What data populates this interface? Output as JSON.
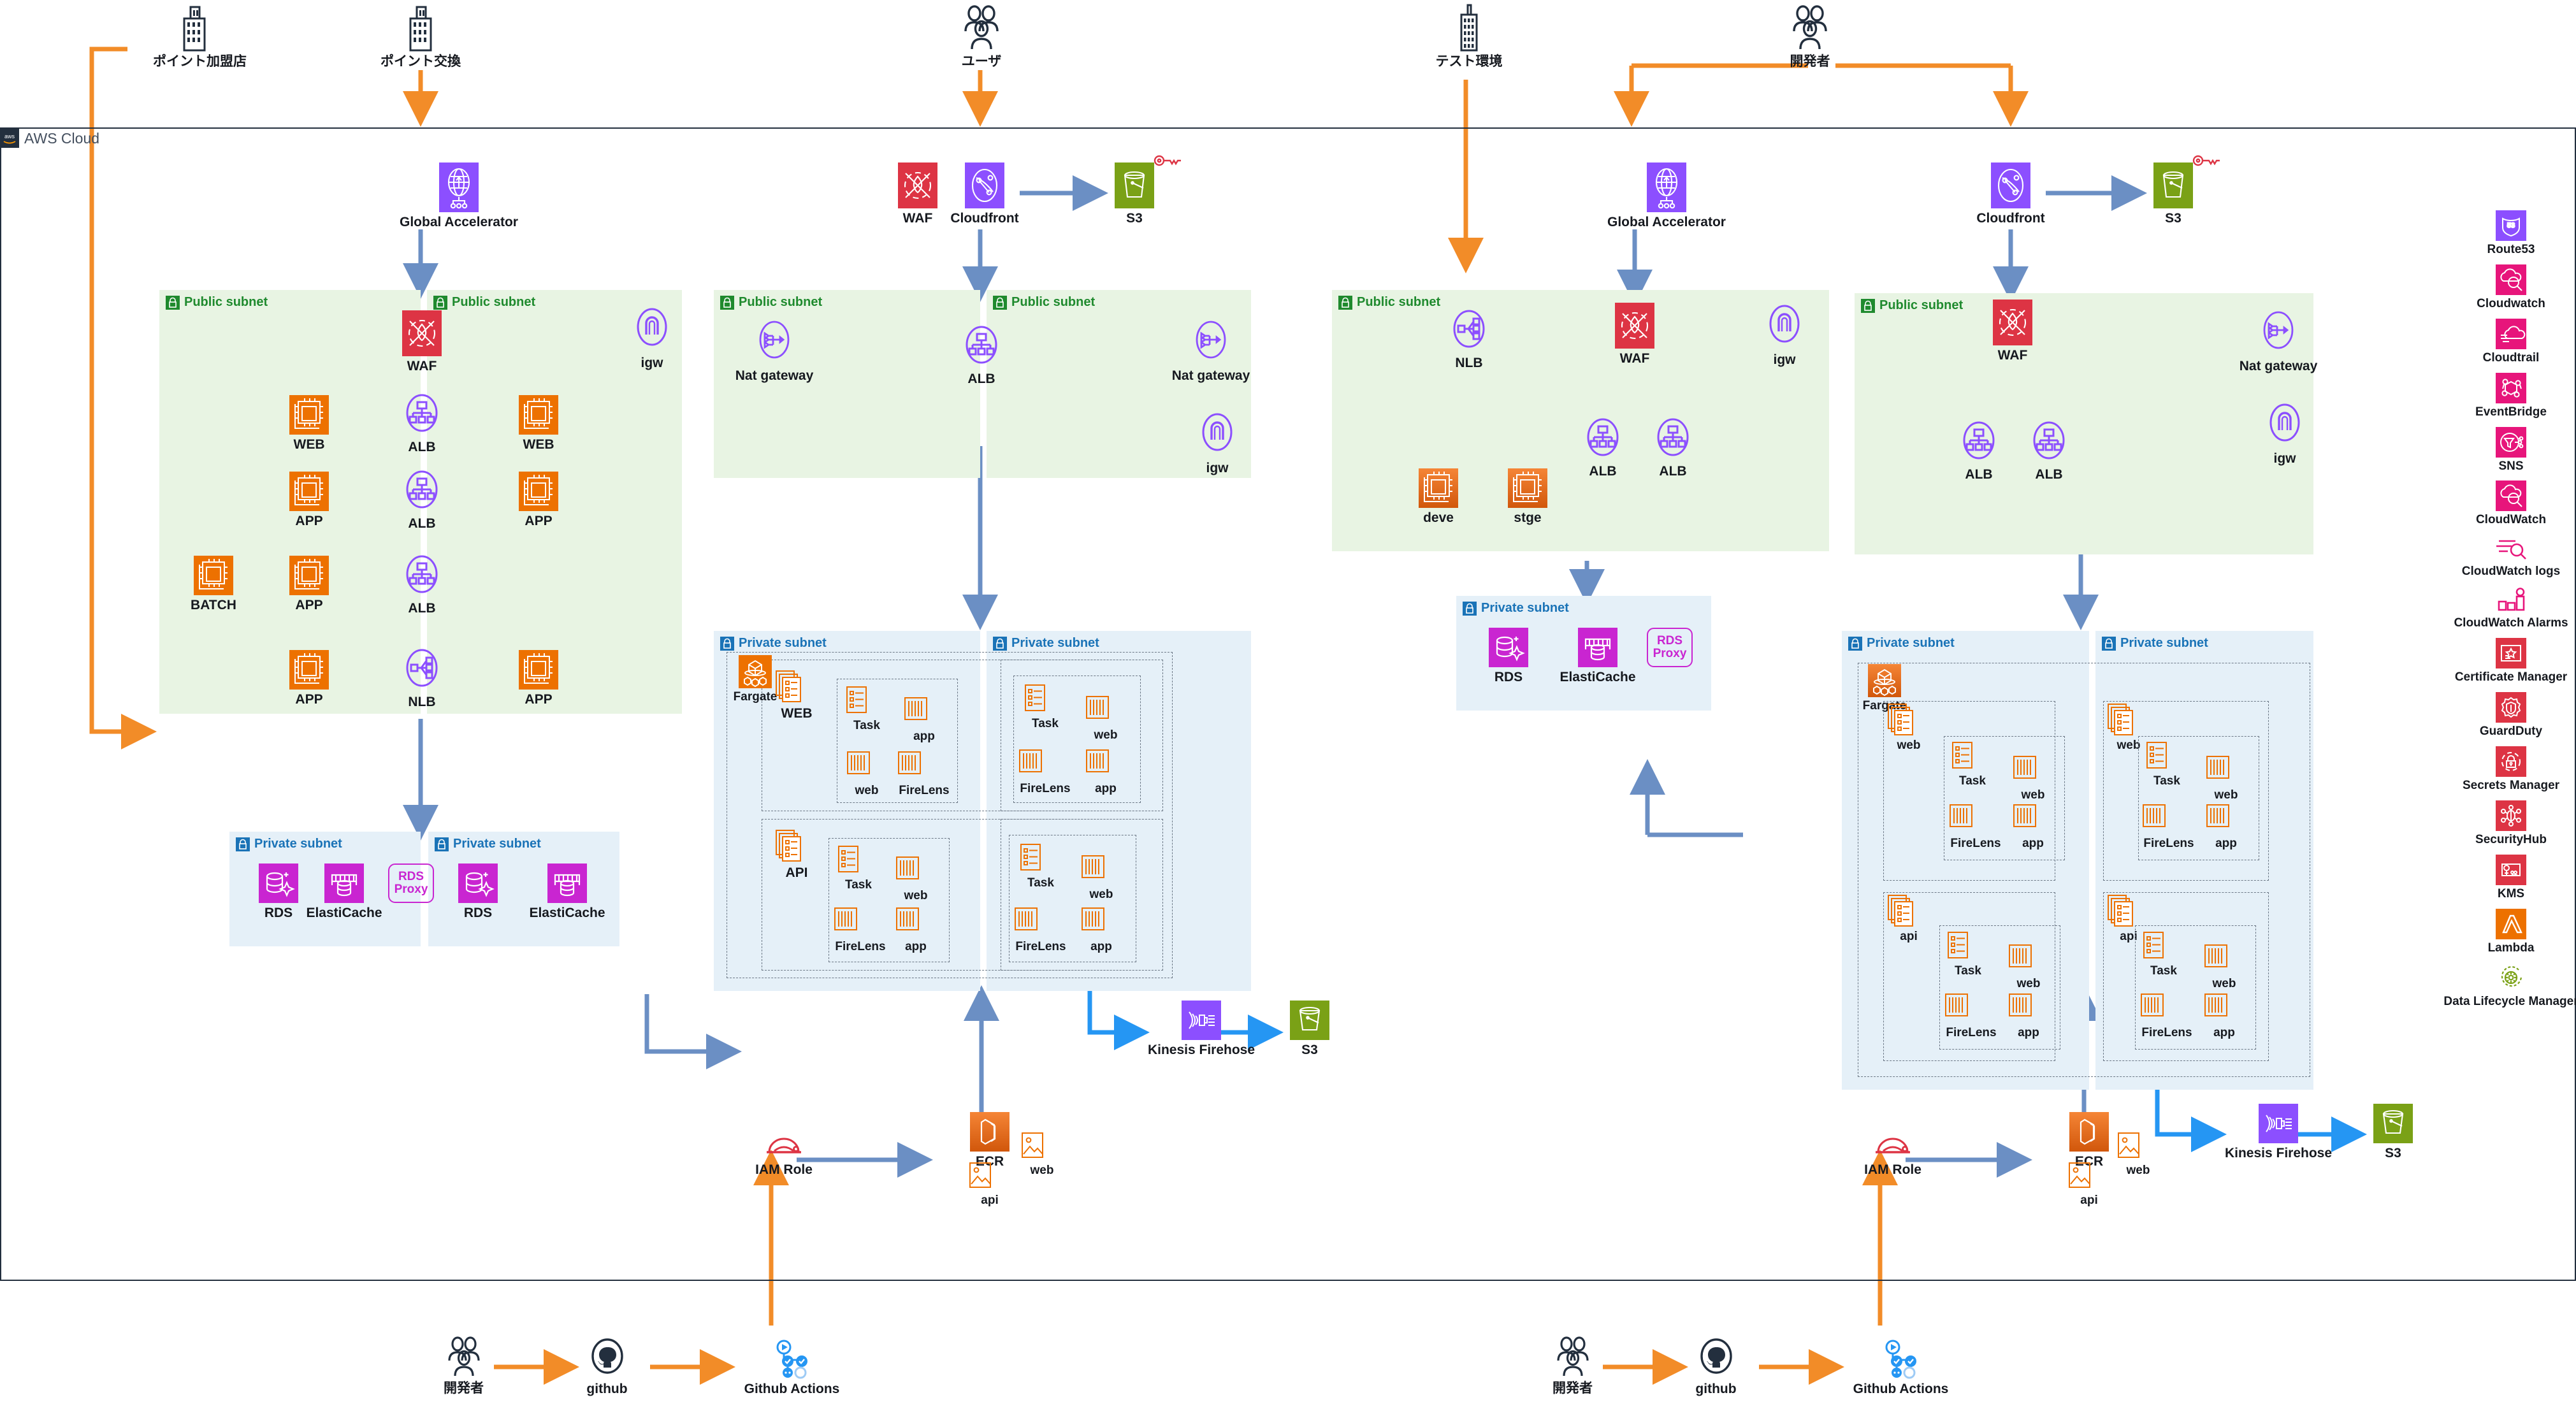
{
  "diagram": {
    "title": "AWS Cloud",
    "cloud_label": "AWS Cloud",
    "aws_badge": "aws"
  },
  "external_actors": [
    {
      "id": "point-merchant",
      "label": "ポイント加盟店",
      "icon": "building-icon"
    },
    {
      "id": "point-exchange",
      "label": "ポイント交換",
      "icon": "building-icon"
    },
    {
      "id": "users",
      "label": "ユーザ",
      "icon": "users-icon"
    },
    {
      "id": "test-env",
      "label": "テスト環境",
      "icon": "building-tall-icon"
    },
    {
      "id": "developers-top",
      "label": "開発者",
      "icon": "users-icon"
    },
    {
      "id": "developer-left",
      "label": "開発者",
      "icon": "users-icon"
    },
    {
      "id": "developer-right",
      "label": "開発者",
      "icon": "users-icon"
    }
  ],
  "edge_services": [
    {
      "id": "ga-left",
      "label": "Global Accelerator",
      "icon": "global-accelerator-icon"
    },
    {
      "id": "waf-mid",
      "label": "WAF",
      "icon": "waf-icon"
    },
    {
      "id": "cloudfront-mid",
      "label": "Cloudfront",
      "icon": "cloudfront-icon"
    },
    {
      "id": "s3-mid",
      "label": "S3",
      "icon": "s3-icon"
    },
    {
      "id": "ga-test",
      "label": "Global Accelerator",
      "icon": "global-accelerator-icon"
    },
    {
      "id": "cloudfront-right",
      "label": "Cloudfront",
      "icon": "cloudfront-icon"
    },
    {
      "id": "s3-right",
      "label": "S3",
      "icon": "s3-icon"
    }
  ],
  "vpc1": {
    "public_subnets": [
      {
        "label": "Public subnet"
      },
      {
        "label": "Public subnet"
      }
    ],
    "nodes": [
      {
        "id": "waf",
        "label": "WAF",
        "icon": "waf-icon"
      },
      {
        "id": "igw",
        "label": "igw",
        "icon": "igw-icon"
      },
      {
        "id": "web-l",
        "label": "WEB",
        "icon": "ec2-icon"
      },
      {
        "id": "alb1",
        "label": "ALB",
        "icon": "alb-icon"
      },
      {
        "id": "web-r",
        "label": "WEB",
        "icon": "ec2-icon"
      },
      {
        "id": "app-l1",
        "label": "APP",
        "icon": "ec2-icon"
      },
      {
        "id": "alb2",
        "label": "ALB",
        "icon": "alb-icon"
      },
      {
        "id": "app-r1",
        "label": "APP",
        "icon": "ec2-icon"
      },
      {
        "id": "batch",
        "label": "BATCH",
        "icon": "ec2-icon"
      },
      {
        "id": "app-l2",
        "label": "APP",
        "icon": "ec2-icon"
      },
      {
        "id": "alb3",
        "label": "ALB",
        "icon": "alb-icon"
      },
      {
        "id": "app-l3",
        "label": "APP",
        "icon": "ec2-icon"
      },
      {
        "id": "nlb1",
        "label": "NLB",
        "icon": "nlb-icon"
      },
      {
        "id": "app-r3",
        "label": "APP",
        "icon": "ec2-icon"
      }
    ],
    "private_subnets": [
      {
        "label": "Private subnet",
        "nodes": [
          {
            "id": "rds-1",
            "label": "RDS",
            "icon": "rds-icon"
          },
          {
            "id": "ec-1",
            "label": "ElastiCache",
            "icon": "elasticache-icon"
          },
          {
            "id": "rdsproxy-1",
            "label": "RDS Proxy",
            "icon": "rds-proxy-icon"
          }
        ]
      },
      {
        "label": "Private subnet",
        "nodes": [
          {
            "id": "rds-2",
            "label": "RDS",
            "icon": "rds-icon"
          },
          {
            "id": "ec-2",
            "label": "ElastiCache",
            "icon": "elasticache-icon"
          }
        ]
      }
    ]
  },
  "vpc2": {
    "public_subnets": [
      {
        "label": "Public subnet",
        "nodes": [
          {
            "id": "natgw-a",
            "label": "Nat gateway",
            "icon": "nat-gateway-icon"
          }
        ]
      },
      {
        "label": "Public subnet",
        "nodes": [
          {
            "id": "alb-mid",
            "label": "ALB",
            "icon": "alb-icon"
          },
          {
            "id": "natgw-b",
            "label": "Nat gateway",
            "icon": "nat-gateway-icon"
          },
          {
            "id": "igw-mid",
            "label": "igw",
            "icon": "igw-icon"
          }
        ]
      }
    ],
    "private_subnets": [
      {
        "label": "Private subnet",
        "fargate": {
          "label": "Fargate",
          "icon": "fargate-icon"
        },
        "services": [
          {
            "name": "WEB",
            "task": "Task",
            "containers": [
              "app",
              "web",
              "FireLens"
            ]
          },
          {
            "name": "API",
            "task": "Task",
            "containers": [
              "web",
              "FireLens",
              "app"
            ]
          }
        ]
      },
      {
        "label": "Private subnet",
        "services": [
          {
            "name": "",
            "task": "Task",
            "containers": [
              "web",
              "FireLens",
              "app"
            ]
          },
          {
            "name": "",
            "task": "Task",
            "containers": [
              "web",
              "FireLens",
              "app"
            ]
          }
        ]
      }
    ],
    "logging": [
      {
        "id": "firehose-mid",
        "label": "Kinesis Firehose",
        "icon": "kinesis-firehose-icon"
      },
      {
        "id": "s3-logs-mid",
        "label": "S3",
        "icon": "s3-icon"
      }
    ],
    "cicd": [
      {
        "id": "iam-mid",
        "label": "IAM Role",
        "icon": "iam-role-icon"
      },
      {
        "id": "ecr-mid",
        "label": "ECR",
        "icon": "ecr-icon"
      },
      {
        "id": "img-web-mid",
        "label": "web",
        "icon": "container-image-icon"
      },
      {
        "id": "img-api-mid",
        "label": "api",
        "icon": "container-image-icon"
      }
    ]
  },
  "vpc3": {
    "public_subnet": {
      "label": "Public subnet"
    },
    "nodes": [
      {
        "id": "nlb-test",
        "label": "NLB",
        "icon": "nlb-icon"
      },
      {
        "id": "waf-test",
        "label": "WAF",
        "icon": "waf-icon"
      },
      {
        "id": "igw-test",
        "label": "igw",
        "icon": "igw-icon"
      },
      {
        "id": "deve",
        "label": "deve",
        "icon": "ec2-icon"
      },
      {
        "id": "stge",
        "label": "stge",
        "icon": "ec2-icon"
      },
      {
        "id": "alb-test-1",
        "label": "ALB",
        "icon": "alb-icon"
      },
      {
        "id": "alb-test-2",
        "label": "ALB",
        "icon": "alb-icon"
      }
    ],
    "private_subnet": {
      "label": "Private subnet",
      "nodes": [
        {
          "id": "rds-test",
          "label": "RDS",
          "icon": "rds-icon"
        },
        {
          "id": "ec-test",
          "label": "ElastiCache",
          "icon": "elasticache-icon"
        },
        {
          "id": "rdsproxy-test",
          "label": "RDS Proxy",
          "icon": "rds-proxy-icon"
        }
      ]
    }
  },
  "vpc4": {
    "public_subnet": {
      "label": "Public subnet",
      "nodes": [
        {
          "id": "waf-r",
          "label": "WAF",
          "icon": "waf-icon"
        },
        {
          "id": "alb-r1",
          "label": "ALB",
          "icon": "alb-icon"
        },
        {
          "id": "alb-r2",
          "label": "ALB",
          "icon": "alb-icon"
        },
        {
          "id": "natgw-r",
          "label": "Nat gateway",
          "icon": "nat-gateway-icon"
        },
        {
          "id": "igw-r",
          "label": "igw",
          "icon": "igw-icon"
        }
      ]
    },
    "private_subnets": [
      {
        "label": "Private subnet",
        "fargate": {
          "label": "Fargate",
          "icon": "fargate-icon"
        },
        "services": [
          {
            "name": "web",
            "task": "Task",
            "containers": [
              "web",
              "FireLens",
              "app"
            ]
          },
          {
            "name": "api",
            "task": "Task",
            "containers": [
              "web",
              "FireLens",
              "app"
            ]
          }
        ]
      },
      {
        "label": "Private subnet",
        "services": [
          {
            "name": "web",
            "task": "Task",
            "containers": [
              "web",
              "FireLens",
              "app"
            ]
          },
          {
            "name": "api",
            "task": "Task",
            "containers": [
              "web",
              "FireLens",
              "app"
            ]
          }
        ]
      }
    ],
    "logging": [
      {
        "id": "firehose-r",
        "label": "Kinesis Firehose",
        "icon": "kinesis-firehose-icon"
      },
      {
        "id": "s3-logs-r",
        "label": "S3",
        "icon": "s3-icon"
      }
    ],
    "cicd": [
      {
        "id": "iam-r",
        "label": "IAM Role",
        "icon": "iam-role-icon"
      },
      {
        "id": "ecr-r",
        "label": "ECR",
        "icon": "ecr-icon"
      },
      {
        "id": "img-web-r",
        "label": "web",
        "icon": "container-image-icon"
      },
      {
        "id": "img-api-r",
        "label": "api",
        "icon": "container-image-icon"
      }
    ]
  },
  "pipeline_left": [
    {
      "id": "dev-l",
      "label": "開発者",
      "icon": "users-icon"
    },
    {
      "id": "github-l",
      "label": "github",
      "icon": "github-icon"
    },
    {
      "id": "gha-l",
      "label": "Github Actions",
      "icon": "github-actions-icon"
    }
  ],
  "pipeline_right": [
    {
      "id": "dev-r",
      "label": "開発者",
      "icon": "users-icon"
    },
    {
      "id": "github-r",
      "label": "github",
      "icon": "github-icon"
    },
    {
      "id": "gha-r",
      "label": "Github Actions",
      "icon": "github-actions-icon"
    }
  ],
  "legend": [
    {
      "id": "route53",
      "label": "Route53",
      "icon": "route53-icon",
      "color": "#8c4fff"
    },
    {
      "id": "cloudwatch-1",
      "label": "Cloudwatch",
      "icon": "cloudwatch-icon",
      "color": "#e7157b"
    },
    {
      "id": "cloudtrail",
      "label": "Cloudtrail",
      "icon": "cloudtrail-icon",
      "color": "#e7157b"
    },
    {
      "id": "eventbridge",
      "label": "EventBridge",
      "icon": "eventbridge-icon",
      "color": "#e7157b"
    },
    {
      "id": "sns",
      "label": "SNS",
      "icon": "sns-icon",
      "color": "#e7157b"
    },
    {
      "id": "cloudwatch-2",
      "label": "CloudWatch",
      "icon": "cloudwatch-icon",
      "color": "#e7157b"
    },
    {
      "id": "cloudwatch-logs",
      "label": "CloudWatch logs",
      "icon": "cloudwatch-logs-icon",
      "color": "#e7157b"
    },
    {
      "id": "cloudwatch-alarms",
      "label": "CloudWatch Alarms",
      "icon": "cloudwatch-alarms-icon",
      "color": "#e7157b"
    },
    {
      "id": "acm",
      "label": "Certificate Manager",
      "icon": "certificate-manager-icon",
      "color": "#dd3444"
    },
    {
      "id": "guardduty",
      "label": "GuardDuty",
      "icon": "guardduty-icon",
      "color": "#dd3444"
    },
    {
      "id": "secrets-manager",
      "label": "Secrets Manager",
      "icon": "secrets-manager-icon",
      "color": "#dd3444"
    },
    {
      "id": "securityhub",
      "label": "SecurityHub",
      "icon": "securityhub-icon",
      "color": "#dd3444"
    },
    {
      "id": "kms",
      "label": "KMS",
      "icon": "kms-icon",
      "color": "#dd3444"
    },
    {
      "id": "lambda",
      "label": "Lambda",
      "icon": "lambda-icon",
      "color": "#ed7100"
    },
    {
      "id": "dlm",
      "label": "Data Lifecycle Manager",
      "icon": "data-lifecycle-manager-icon",
      "color": "#7aa116"
    }
  ],
  "colors": {
    "orange_flow": "#f28c28",
    "blue_flow": "#6b8fc4",
    "bright_blue_flow": "#2596f3",
    "public_subnet_bg": "#e8f4e3",
    "private_subnet_bg": "#e5f0f8",
    "aws_navy": "#232f3e"
  }
}
